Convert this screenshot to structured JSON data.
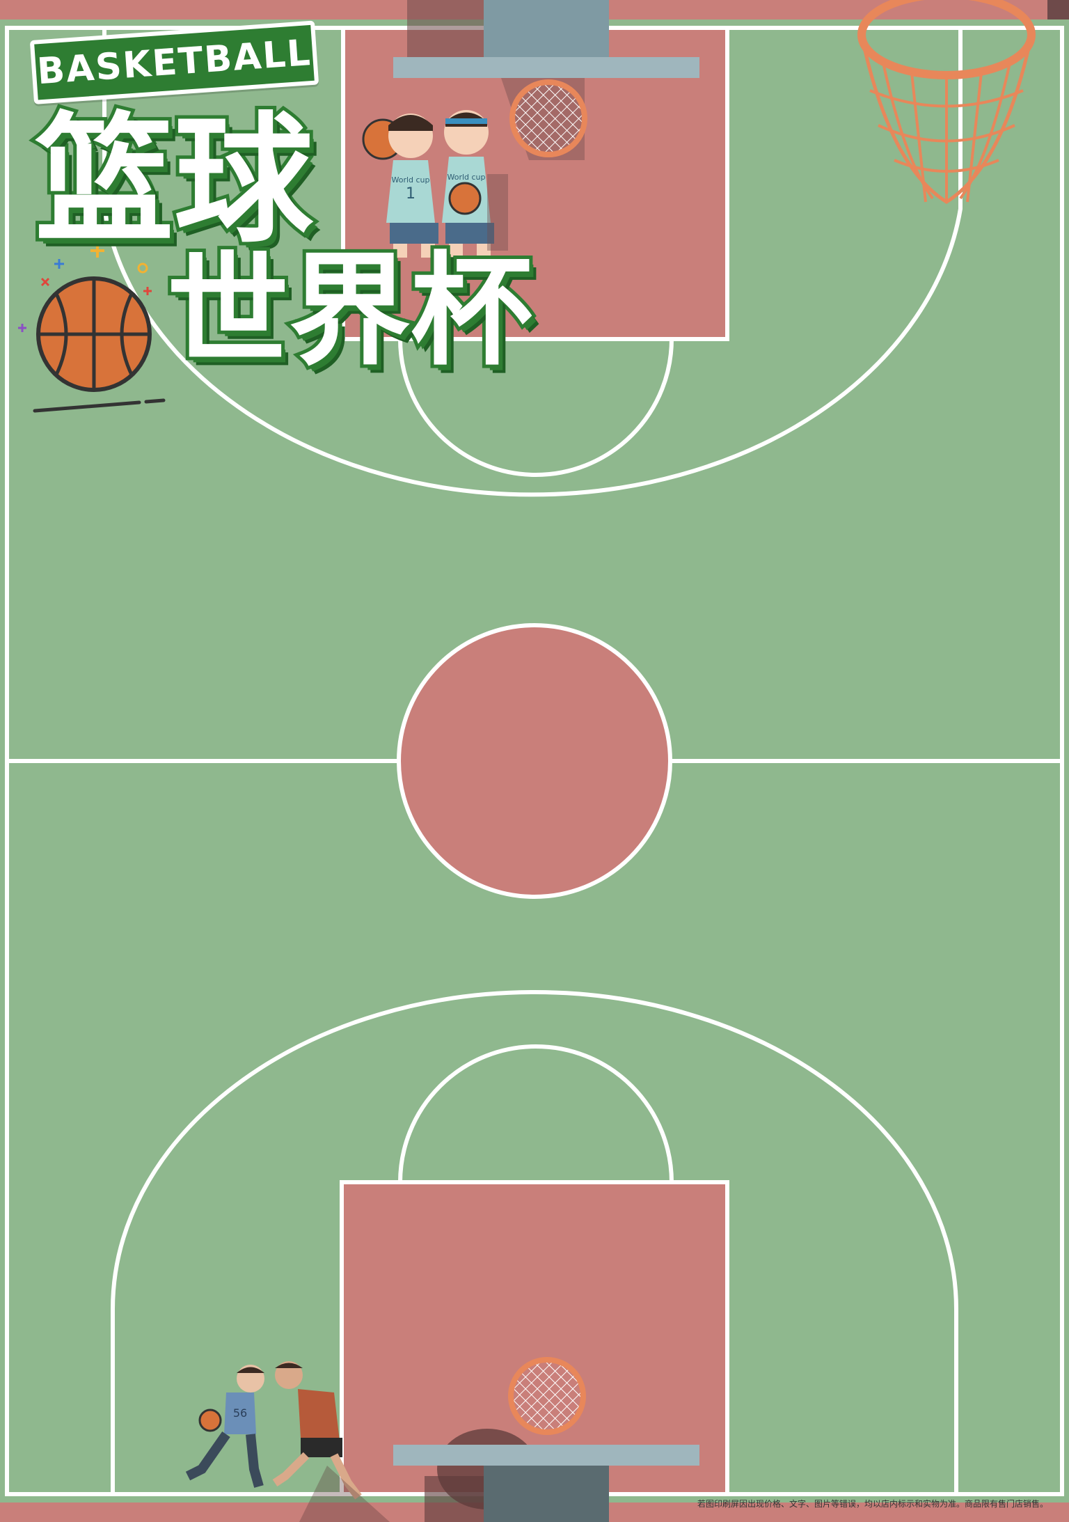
{
  "header": {
    "badge_text": "BASKETBALL",
    "title_line1": "篮球",
    "title_line2": "世界杯"
  },
  "jerseys": {
    "left_number": "1",
    "left_text": "World cup",
    "right_text": "World cup"
  },
  "players_bottom": {
    "left_jersey_number": "56"
  },
  "footer": {
    "fine_print": "若图印刷屏因出现价格、文字、图片等错误，均以店内标示和实物为准。商品限有售门店销售。"
  },
  "colors": {
    "court_green": "#8fb88e",
    "paint_red": "#c97f7a",
    "line_white": "#ffffff",
    "title_green": "#2e7d32",
    "rim_orange": "#e8875a",
    "ball_orange": "#d8733a"
  },
  "icons": [
    "basketball-icon",
    "sparkle-icon",
    "hoop-icon",
    "backboard-icon",
    "player-figure"
  ]
}
